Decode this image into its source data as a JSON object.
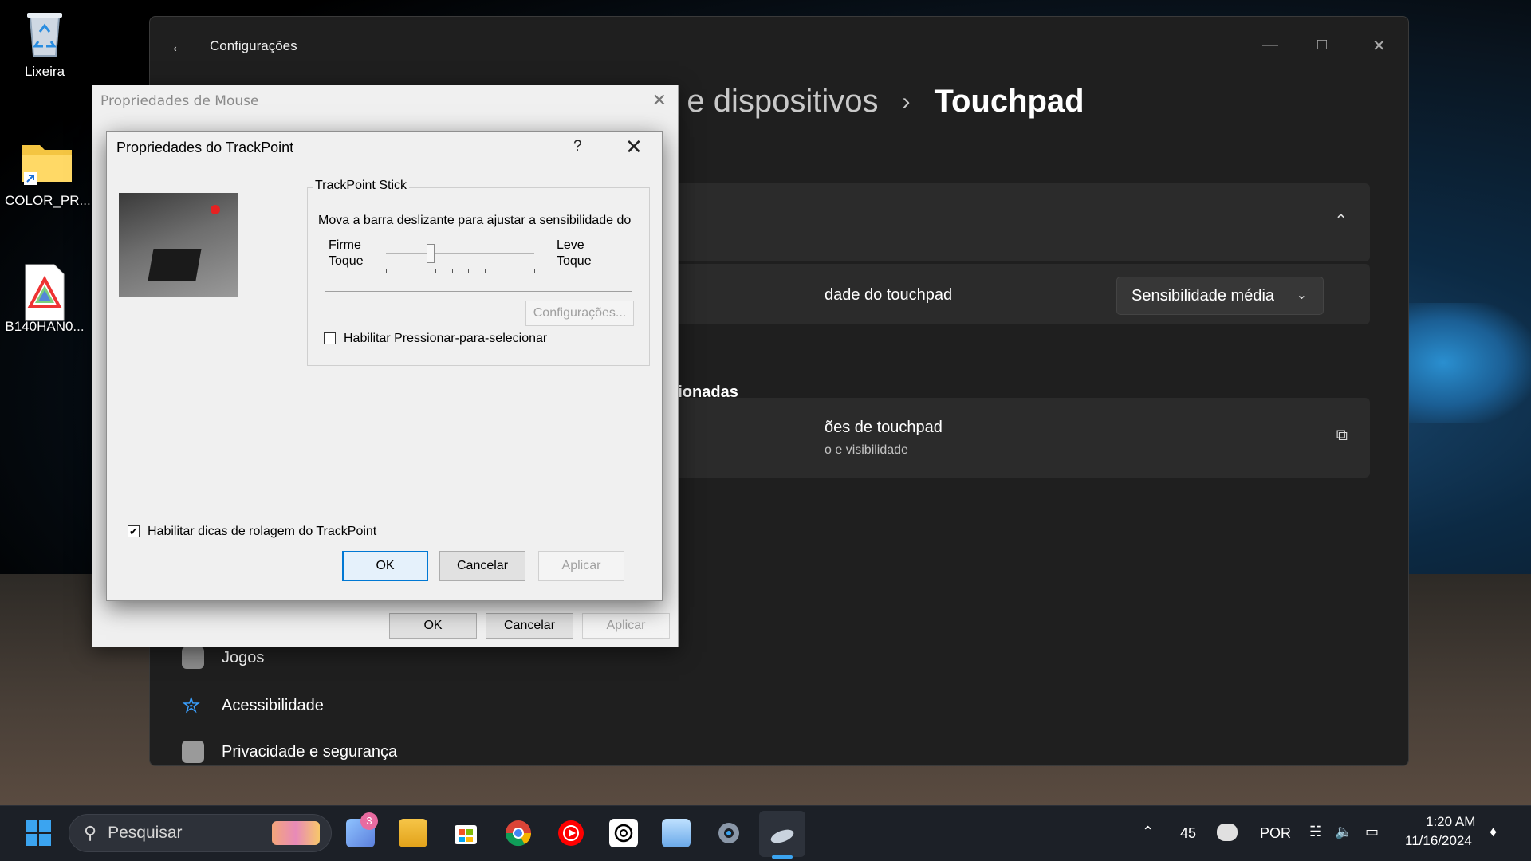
{
  "desktop": {
    "icons": [
      {
        "label": "Lixeira",
        "icon": "recycle-bin-icon"
      },
      {
        "label": "COLOR_PR...",
        "icon": "folder-shortcut-icon"
      },
      {
        "label": "B140HAN0...",
        "icon": "color-profile-icon"
      }
    ]
  },
  "settings": {
    "app_title": "Configurações",
    "back_icon": "arrow-left-icon",
    "breadcrumb": {
      "parent": "n e dispositivos",
      "current": "Touchpad"
    },
    "row_sensitivity": {
      "label": "dade do touchpad",
      "value": "Sensibilidade média"
    },
    "related_section": "acionadas",
    "related_link": {
      "title": "ões de touchpad",
      "subtitle": "o e visibilidade"
    },
    "nav": [
      {
        "label": "Jogos",
        "icon": "gamepad-icon"
      },
      {
        "label": "Acessibilidade",
        "icon": "accessibility-icon"
      },
      {
        "label": "Privacidade e segurança",
        "icon": "shield-icon"
      }
    ]
  },
  "mouse_props": {
    "title": "Propriedades de Mouse",
    "ok": "OK",
    "cancel": "Cancelar",
    "apply": "Aplicar"
  },
  "trackpoint": {
    "title": "Propriedades do TrackPoint",
    "help": "?",
    "group_title": "TrackPoint Stick",
    "description": "Mova a barra deslizante para ajustar a sensibilidade do",
    "left_label_1": "Firme",
    "left_label_2": "Toque",
    "right_label_1": "Leve",
    "right_label_2": "Toque",
    "sensitivity_level": 0.3,
    "config_button": "Configurações...",
    "press_to_select": {
      "label": "Habilitar Pressionar-para-selecionar",
      "checked": false
    },
    "scroll_tips": {
      "label": "Habilitar dicas de rolagem do TrackPoint",
      "checked": true
    },
    "ok": "OK",
    "cancel": "Cancelar",
    "apply": "Aplicar"
  },
  "taskbar": {
    "search_placeholder": "Pesquisar",
    "weather_badge": "3",
    "temperature": "45",
    "language": "POR",
    "time": "1:20 AM",
    "date": "11/16/2024",
    "apps": [
      "start-icon",
      "weather-icon",
      "file-explorer-icon",
      "store-icon",
      "chrome-icon",
      "youtube-music-icon",
      "chatgpt-icon",
      "photos-icon",
      "settings-icon",
      "mouse-app-icon"
    ]
  },
  "colors": {
    "accent": "#0078d4",
    "settings_bg": "#1f1f1f",
    "dialog_bg": "#f0f0f0",
    "taskbar_bg": "#1c2027"
  }
}
